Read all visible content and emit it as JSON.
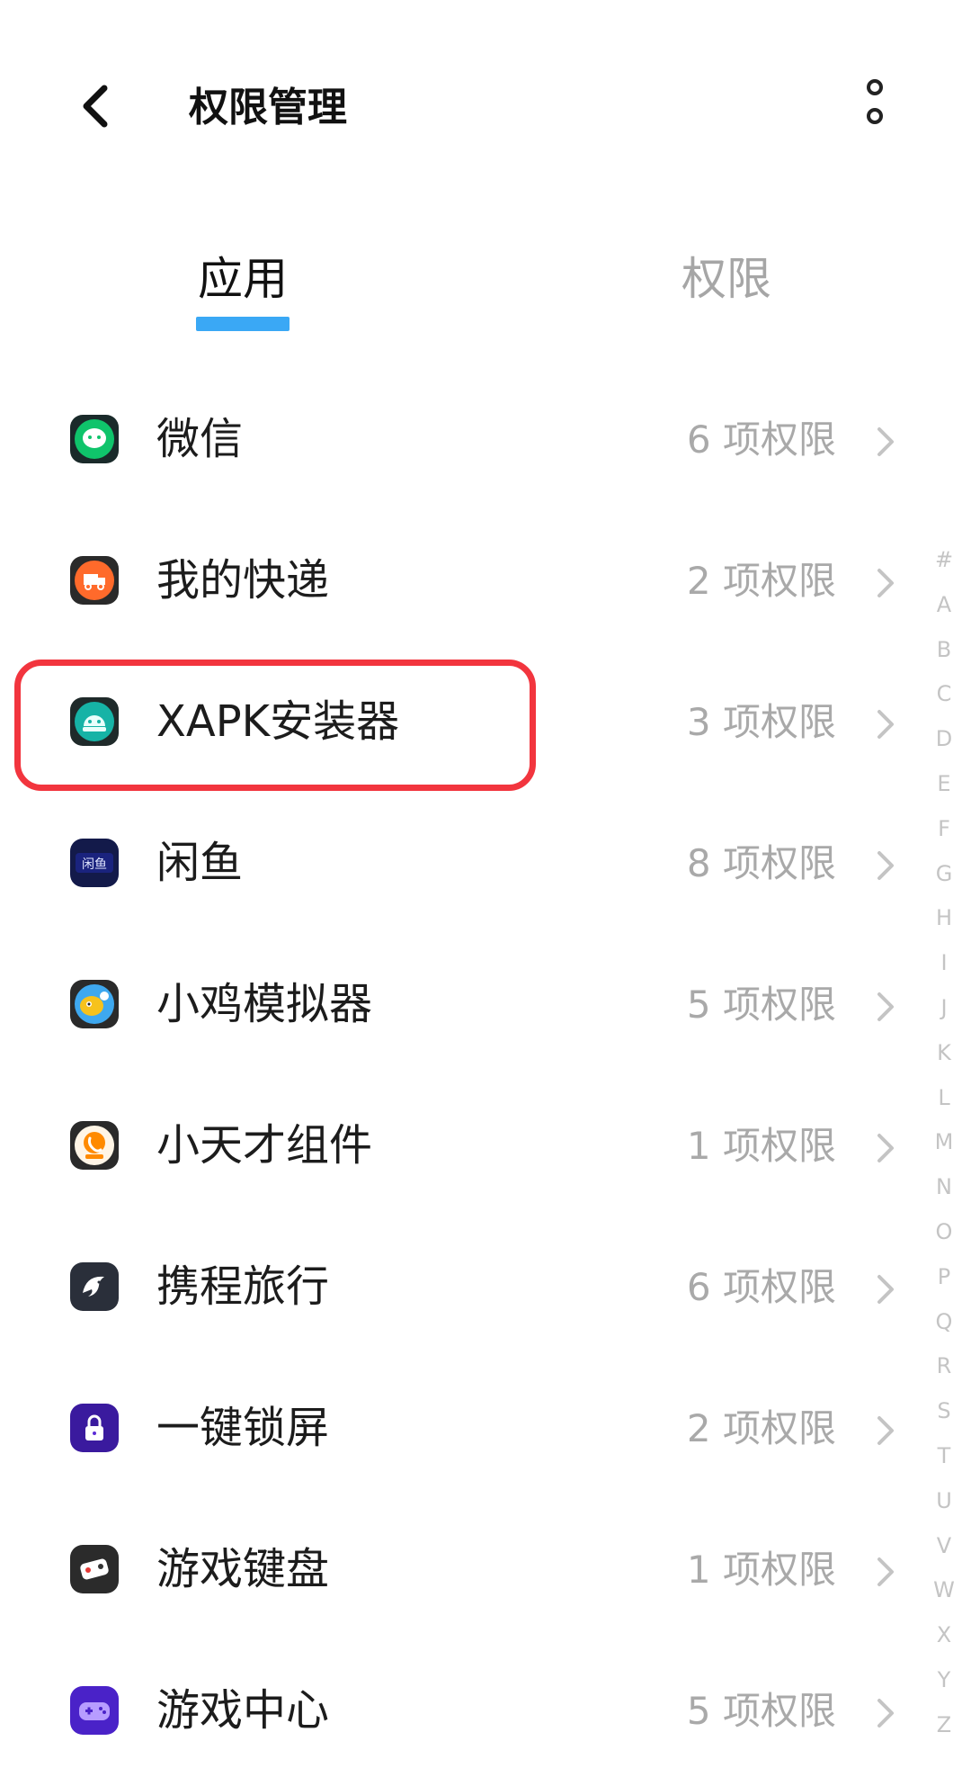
{
  "header": {
    "title": "权限管理"
  },
  "tabs": [
    {
      "label": "应用",
      "active": true
    },
    {
      "label": "权限",
      "active": false
    }
  ],
  "apps": [
    {
      "name": "微信",
      "count": "6 项权限",
      "icon": "wechat-icon",
      "color": "#0fc46b"
    },
    {
      "name": "我的快递",
      "count": "2 项权限",
      "icon": "delivery-truck-icon",
      "color": "#ff6a2b"
    },
    {
      "name": "XAPK安装器",
      "count": "3 项权限",
      "icon": "android-robot-icon",
      "color": "#16b3a6"
    },
    {
      "name": "闲鱼",
      "count": "8 项权限",
      "icon": "xianyu-logo-icon",
      "color": "#1a237e"
    },
    {
      "name": "小鸡模拟器",
      "count": "5 项权限",
      "icon": "chick-emulator-icon",
      "color": "#f6c21c"
    },
    {
      "name": "小天才组件",
      "count": "1 项权限",
      "icon": "phone-call-icon",
      "color": "#ff8a00"
    },
    {
      "name": "携程旅行",
      "count": "6 项权限",
      "icon": "dolphin-icon",
      "color": "#2a2f3a"
    },
    {
      "name": "一键锁屏",
      "count": "2 项权限",
      "icon": "padlock-icon",
      "color": "#5b2bd6"
    },
    {
      "name": "游戏键盘",
      "count": "1 项权限",
      "icon": "game-keyboard-icon",
      "color": "#333333"
    },
    {
      "name": "游戏中心",
      "count": "5 项权限",
      "icon": "gamepad-icon",
      "color": "#6a3cf0"
    }
  ],
  "alphabet_index": [
    "#",
    "A",
    "B",
    "C",
    "D",
    "E",
    "F",
    "G",
    "H",
    "I",
    "J",
    "K",
    "L",
    "M",
    "N",
    "O",
    "P",
    "Q",
    "R",
    "S",
    "T",
    "U",
    "V",
    "W",
    "X",
    "Y",
    "Z"
  ],
  "highlight_color": "#f2353e",
  "tab_indicator_color": "#3aa8f5"
}
